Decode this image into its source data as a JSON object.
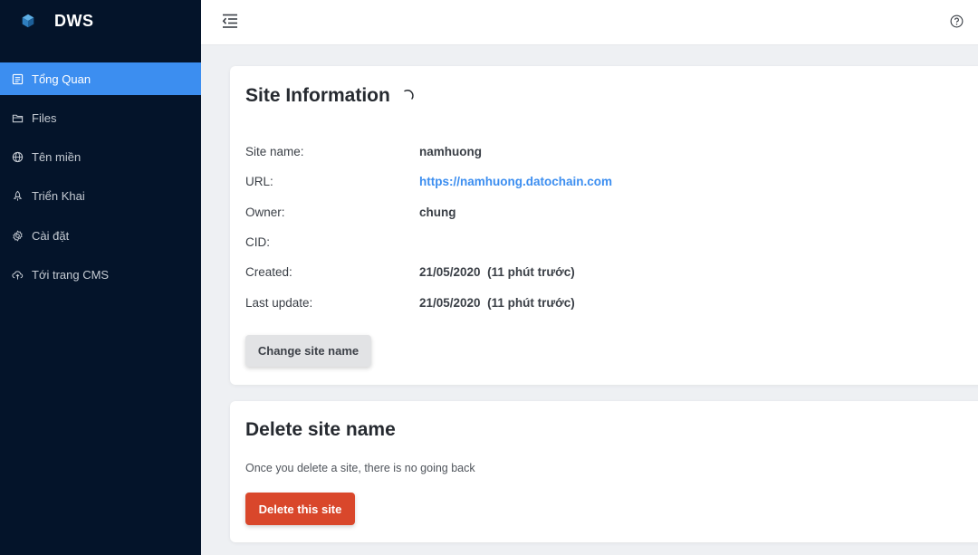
{
  "app": {
    "name": "DWS"
  },
  "sidebar": {
    "items": [
      {
        "label": "Tổng Quan",
        "icon": "dashboard-icon",
        "active": true
      },
      {
        "label": "Files",
        "icon": "folder-icon"
      },
      {
        "label": "Tên miền",
        "icon": "globe-icon"
      },
      {
        "label": "Triển Khai",
        "icon": "rocket-icon"
      },
      {
        "label": "Cài đặt",
        "icon": "gear-icon"
      },
      {
        "label": "Tới trang CMS",
        "icon": "cloud-upload-icon"
      }
    ]
  },
  "site_info": {
    "title": "Site Information",
    "rows": [
      {
        "label": "Site name:",
        "value": "namhuong"
      },
      {
        "label": "URL:",
        "value": "https://namhuong.datochain.com"
      },
      {
        "label": "Owner:",
        "value": "chung"
      },
      {
        "label": "CID:",
        "value": ""
      },
      {
        "label": "Created:",
        "value": "21/05/2020  (11 phút trước)"
      },
      {
        "label": "Last update:",
        "value": "21/05/2020  (11 phút trước)"
      }
    ],
    "change_button": "Change site name"
  },
  "delete_site": {
    "title": "Delete site name",
    "description": "Once you delete a site, there is no going back",
    "button": "Delete this site"
  },
  "colors": {
    "sidebar_bg": "#04142a",
    "accent": "#3c8ef0",
    "danger": "#d9472b"
  }
}
